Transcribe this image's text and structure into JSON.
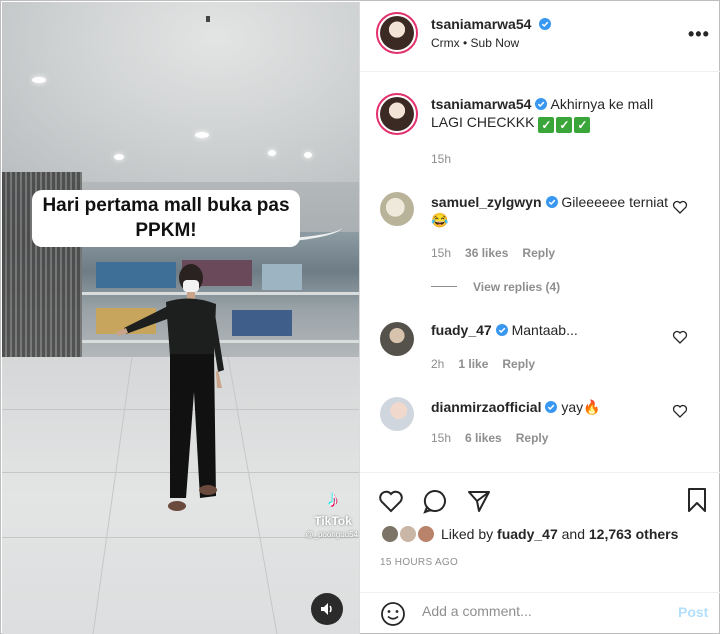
{
  "video": {
    "caption_line1": "Hari pertama mall buka pas",
    "caption_line2": "PPKM!",
    "watermark_brand": "TikTok",
    "watermark_handle": "@_poohguu54"
  },
  "header": {
    "username": "tsaniamarwa54",
    "subtitle": "Crmx • Sub Now",
    "more_label": "•••"
  },
  "post": {
    "username": "tsaniamarwa54",
    "caption": "Akhirnya ke mall LAGI CHECKKK",
    "check_marks": [
      "✓",
      "✓",
      "✓"
    ],
    "time": "15h"
  },
  "comments": [
    {
      "username": "samuel_zylgwyn",
      "text": "Gileeeeee terniat😂",
      "time": "15h",
      "likes": "36 likes",
      "reply": "Reply"
    },
    {
      "username": "fuady_47",
      "text": "Mantaab...",
      "time": "2h",
      "likes": "1 like",
      "reply": "Reply"
    },
    {
      "username": "dianmirzaofficial",
      "text": "yay🔥",
      "time": "15h",
      "likes": "6 likes",
      "reply": "Reply"
    }
  ],
  "view_replies": "View replies (4)",
  "likes": {
    "prefix": "Liked by",
    "user": "fuady_47",
    "connector": "and",
    "others": "12,763 others"
  },
  "post_time": "15 HOURS AGO",
  "comment_box": {
    "placeholder": "Add a comment...",
    "post_label": "Post"
  },
  "colors": {
    "verified": "#3897f0",
    "story_ring": "#e1306c",
    "post_button": "#b2dffc",
    "muted_text": "#8e8e8e"
  },
  "icons": [
    "verified-icon",
    "more-icon",
    "heart-icon",
    "comment-icon",
    "share-icon",
    "bookmark-icon",
    "emoji-icon",
    "volume-icon",
    "tiktok-icon"
  ]
}
